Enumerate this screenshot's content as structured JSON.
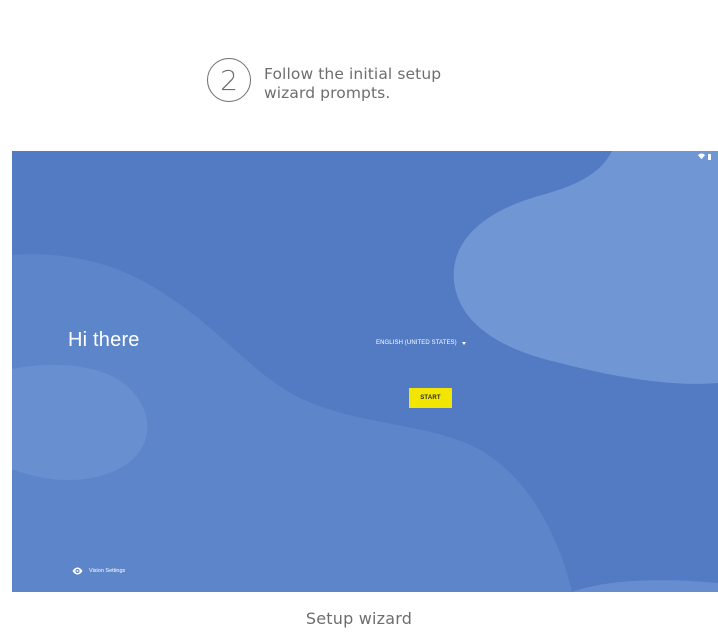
{
  "step": {
    "number": "2",
    "text": "Follow the initial setup wizard prompts."
  },
  "screen": {
    "colors": {
      "background": "#527bc4",
      "wave_light": "#7299d4",
      "wave_mid": "#6189cc",
      "button": "#f2e600"
    },
    "status_icons": [
      "wifi-icon",
      "battery-icon"
    ],
    "greeting": "Hi there",
    "language": "ENGLISH (UNITED STATES)",
    "start_label": "START",
    "vision_settings_label": "Vision Settings"
  },
  "caption": "Setup wizard"
}
